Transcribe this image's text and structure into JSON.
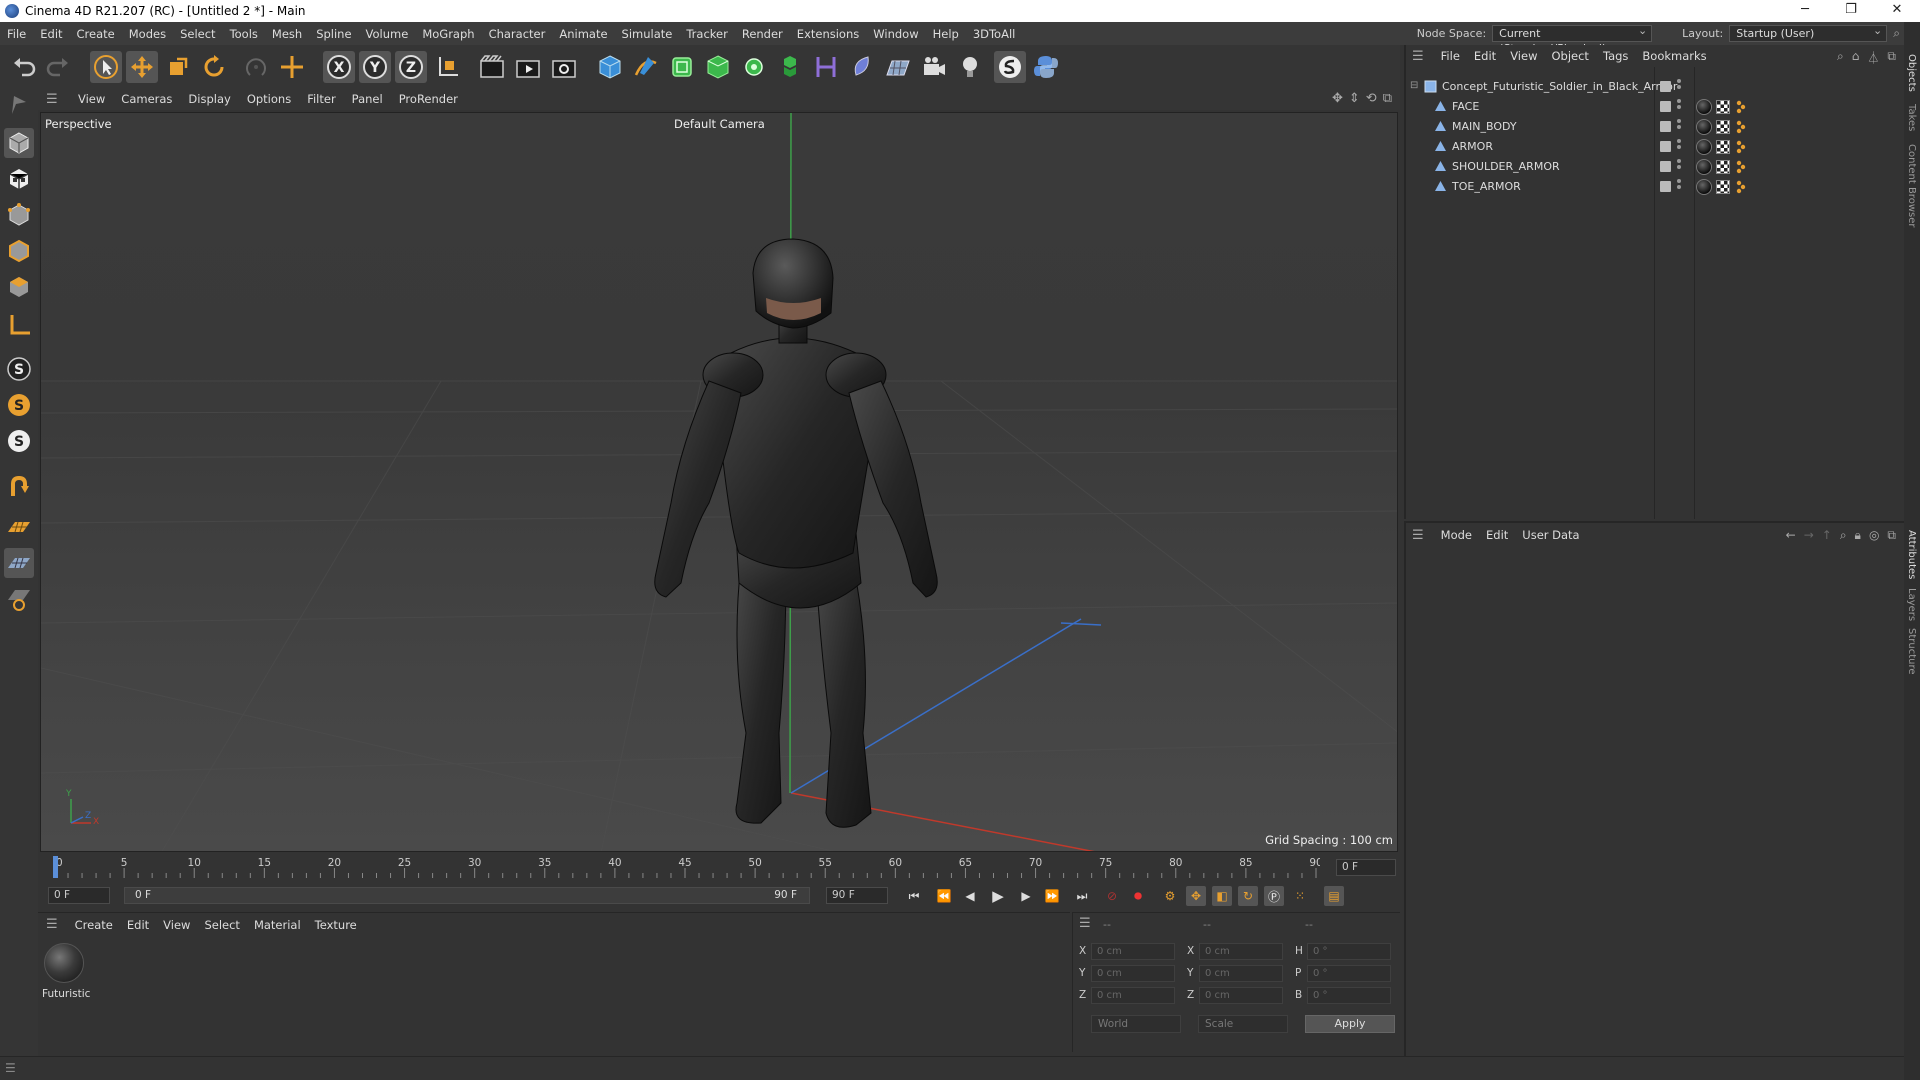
{
  "window": {
    "title": "Cinema 4D R21.207 (RC) - [Untitled 2 *] - Main",
    "controls": [
      "─",
      "❐",
      "✕"
    ]
  },
  "menu": [
    "File",
    "Edit",
    "Create",
    "Modes",
    "Select",
    "Tools",
    "Mesh",
    "Spline",
    "Volume",
    "MoGraph",
    "Character",
    "Animate",
    "Simulate",
    "Tracker",
    "Render",
    "Extensions",
    "Window",
    "Help",
    "3DToAll"
  ],
  "node_space": {
    "label": "Node Space:",
    "value": "Current (Standard/Physical)"
  },
  "layout": {
    "label": "Layout:",
    "value": "Startup (User)"
  },
  "side_tabs": [
    "Objects",
    "Takes",
    "Content Browser",
    "Attributes",
    "Layers",
    "Structure"
  ],
  "viewport": {
    "menu": [
      "View",
      "Cameras",
      "Display",
      "Options",
      "Filter",
      "Panel",
      "ProRender"
    ],
    "view_name": "Perspective",
    "camera": "Default Camera",
    "grid_spacing": "Grid Spacing : 100 cm",
    "axis_y": "Y",
    "axis_x": "X",
    "axis_z": "Z"
  },
  "timeline": {
    "ticks": [
      "0",
      "5",
      "10",
      "15",
      "20",
      "25",
      "30",
      "35",
      "40",
      "45",
      "50",
      "55",
      "60",
      "65",
      "70",
      "75",
      "80",
      "85",
      "90"
    ],
    "current_frame": "0 F",
    "start": "0 F",
    "range_start": "0 F",
    "range_end": "90 F",
    "end": "90 F"
  },
  "material_panel": {
    "menu": [
      "Create",
      "Edit",
      "View",
      "Select",
      "Material",
      "Texture"
    ],
    "materials": [
      {
        "name": "Futuristic"
      }
    ]
  },
  "coordinates": {
    "header": [
      "--",
      "--",
      "--"
    ],
    "rows": [
      {
        "a": "X",
        "av": "0 cm",
        "b": "X",
        "bv": "0 cm",
        "c": "H",
        "cv": "0 °"
      },
      {
        "a": "Y",
        "av": "0 cm",
        "b": "Y",
        "bv": "0 cm",
        "c": "P",
        "cv": "0 °"
      },
      {
        "a": "Z",
        "av": "0 cm",
        "b": "Z",
        "bv": "0 cm",
        "c": "B",
        "cv": "0 °"
      }
    ],
    "mode1": "World",
    "mode2": "Scale",
    "apply": "Apply"
  },
  "object_manager": {
    "menu": [
      "File",
      "Edit",
      "View",
      "Object",
      "Tags",
      "Bookmarks"
    ],
    "root": "Concept_Futuristic_Soldier_in_Black_Armor",
    "children": [
      "FACE",
      "MAIN_BODY",
      "ARMOR",
      "SHOULDER_ARMOR",
      "TOE_ARMOR"
    ]
  },
  "attributes": {
    "menu": [
      "Mode",
      "Edit",
      "User Data"
    ]
  }
}
